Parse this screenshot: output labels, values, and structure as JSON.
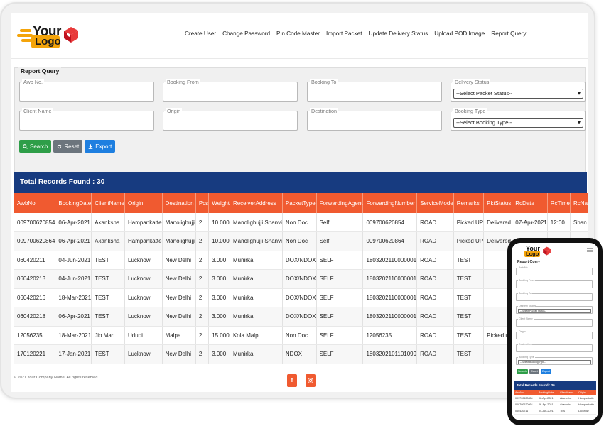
{
  "logo": {
    "line1": "Your",
    "line2": "Logo"
  },
  "nav": [
    "Create User",
    "Change Password",
    "Pin Code Master",
    "Import Packet",
    "Update Delivery Status",
    "Upload POD Image",
    "Report Query"
  ],
  "report_query": {
    "title": "Report Query",
    "fields": {
      "awb": {
        "label": "Awb No.",
        "value": ""
      },
      "booking_from": {
        "label": "Booking From",
        "value": ""
      },
      "booking_to": {
        "label": "Booking To",
        "value": ""
      },
      "delivery_status": {
        "label": "Delivery Status",
        "selected": "--Select Packet Status--"
      },
      "client_name": {
        "label": "Client Name",
        "value": ""
      },
      "origin": {
        "label": "Origin",
        "value": ""
      },
      "destination": {
        "label": "Destination",
        "value": ""
      },
      "booking_type": {
        "label": "Booking Type",
        "selected": "--Select Booking Type--"
      }
    },
    "buttons": {
      "search": "Search",
      "reset": "Reset",
      "export": "Export"
    }
  },
  "total_records": "Total Records Found : 30",
  "table": {
    "columns": [
      "AwbNo",
      "BookingDate",
      "ClientName",
      "Origin",
      "Destination",
      "Pcs",
      "Weight",
      "ReceiverAddress",
      "PacketType",
      "ForwardingAgent",
      "ForwardingNumber",
      "ServiceMode",
      "Remarks",
      "PktStatus",
      "RcDate",
      "RcTime",
      "RcNa"
    ],
    "rows": [
      [
        "009700620854",
        "06-Apr-2021",
        "Akanksha",
        "Hampankatte",
        "Manolighujji",
        "2",
        "10.000",
        "Manolighujji Shanvi",
        "Non Doc",
        "Self",
        "009700620854",
        "ROAD",
        "Picked UP",
        "Delivered",
        "07-Apr-2021",
        "12:00",
        "Shan"
      ],
      [
        "009700620864",
        "06-Apr-2021",
        "Akanksha",
        "Hampankatte",
        "Manolighujji",
        "2",
        "10.000",
        "Manolighujji Shanvi",
        "Non Doc",
        "Self",
        "009700620864",
        "ROAD",
        "Picked UP",
        "Delivered",
        "",
        "",
        ""
      ],
      [
        "060420211",
        "04-Jun-2021",
        "TEST",
        "Lucknow",
        "New Delhi",
        "2",
        "3.000",
        "Munirka",
        "DOX/NDOX",
        "SELF",
        "1803202110000001",
        "ROAD",
        "TEST",
        "",
        "",
        "",
        ""
      ],
      [
        "060420213",
        "04-Jun-2021",
        "TEST",
        "Lucknow",
        "New Delhi",
        "2",
        "3.000",
        "Munirka",
        "DOX/NDOX",
        "SELF",
        "1803202110000001",
        "ROAD",
        "TEST",
        "",
        "",
        "",
        ""
      ],
      [
        "060420216",
        "18-Mar-2021",
        "TEST",
        "Lucknow",
        "New Delhi",
        "2",
        "3.000",
        "Munirka",
        "DOX/NDOX",
        "SELF",
        "1803202110000001",
        "ROAD",
        "TEST",
        "",
        "",
        "",
        ""
      ],
      [
        "060420218",
        "06-Apr-2021",
        "TEST",
        "Lucknow",
        "New Delhi",
        "2",
        "3.000",
        "Munirka",
        "DOX/NDOX",
        "SELF",
        "1803202110000001",
        "ROAD",
        "TEST",
        "",
        "",
        "",
        ""
      ],
      [
        "12056235",
        "18-Mar-2021",
        "Jio Mart",
        "Udupi",
        "Malpe",
        "2",
        "15.000",
        "Kola Malp",
        "Non Doc",
        "SELF",
        "12056235",
        "ROAD",
        "TEST",
        "Picked up",
        "",
        "",
        ""
      ],
      [
        "170120221",
        "17-Jan-2021",
        "TEST",
        "Lucknow",
        "New Delhi",
        "2",
        "3.000",
        "Munirka",
        "NDOX",
        "SELF",
        "1803202101101099",
        "ROAD",
        "TEST",
        "",
        "",
        "",
        ""
      ]
    ]
  },
  "footer": {
    "copyright": "© 2021 Your Company Name. All rights reserved."
  },
  "icons": {
    "facebook": "facebook-icon",
    "instagram": "instagram-icon"
  },
  "colors": {
    "accent": "#f05a30",
    "header_bar": "#173b80",
    "search": "#2e9e48",
    "reset": "#6c757d",
    "export": "#1e7fe0",
    "logo": "#f4a40a"
  },
  "mobile": {
    "title": "Report Query",
    "labels": [
      "Awb No.",
      "Booking From",
      "Booking To",
      "Delivery Status",
      "Client Name",
      "Origin",
      "Destination",
      "Booking Type"
    ],
    "delivery_select": "--Select Packet Status--",
    "booking_select": "--Select Booking Type--",
    "buttons": [
      "Search",
      "Reset",
      "Export"
    ],
    "total": "Total Records Found : 30",
    "columns": [
      "AwbNo",
      "BookingDate",
      "ClientName",
      "Origin"
    ],
    "rows": [
      [
        "009700620854",
        "06-Apr-2021",
        "Akanksha",
        "Hampankatte"
      ],
      [
        "009700620864",
        "06-Apr-2021",
        "Akanksha",
        "Hampankatte"
      ],
      [
        "060420211",
        "04-Jun-2021",
        "TEST",
        "Lucknow"
      ]
    ]
  }
}
